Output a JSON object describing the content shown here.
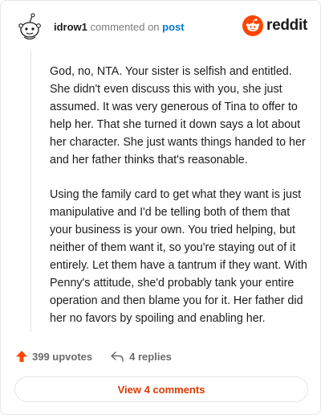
{
  "header": {
    "username": "idrow1",
    "action_text": "commented on",
    "post_link": "post",
    "brand": "reddit"
  },
  "comment": {
    "paragraphs": [
      "God, no, NTA. Your sister is selfish and entitled. She didn't even discuss this with you, she just assumed. It was very generous of Tina to offer to help her. That she turned it down says a lot about her character. She just wants things handed to her and her father thinks that's reasonable.",
      "Using the family card to get what they want is just manipulative and I'd be telling both of them that your business is your own. You tried helping, but neither of them want it, so you're staying out of it entirely. Let them have a tantrum if they want. With Penny's attitude, she'd probably tank your entire operation and then blame you for it. Her father did her no favors by spoiling and enabling her."
    ]
  },
  "actions": {
    "upvotes": "399 upvotes",
    "replies": "4 replies"
  },
  "view_button": "View 4 comments",
  "colors": {
    "brand_orange": "#ff4500",
    "link_blue": "#0079d3",
    "view_orange": "#d93a00"
  }
}
